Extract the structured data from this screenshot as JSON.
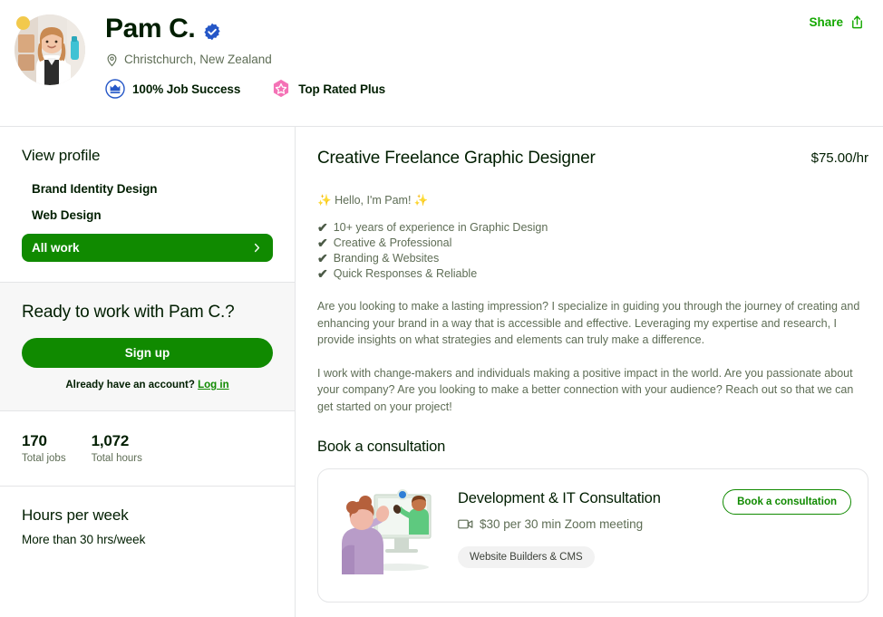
{
  "header": {
    "name": "Pam C.",
    "verified_icon": "verified-badge-icon",
    "location_icon": "location-pin-icon",
    "location": "Christchurch, New Zealand",
    "badges": [
      {
        "icon": "job-success-crown-icon",
        "label": "100% Job Success",
        "color": "#1f57c3"
      },
      {
        "icon": "top-rated-plus-star-icon",
        "label": "Top Rated Plus",
        "color": "#f472b6"
      }
    ],
    "share_label": "Share",
    "share_icon": "share-upload-icon"
  },
  "sidebar": {
    "view_profile_label": "View profile",
    "nav_items": [
      {
        "label": "Brand Identity Design"
      },
      {
        "label": "Web Design"
      }
    ],
    "all_work_label": "All work",
    "all_work_icon": "chevron-right-icon",
    "cta": {
      "title": "Ready to work with Pam C.?",
      "signup_label": "Sign up",
      "account_prompt": "Already have an account?",
      "login_label": "Log in"
    },
    "stats": [
      {
        "value": "170",
        "label": "Total jobs"
      },
      {
        "value": "1,072",
        "label": "Total hours"
      }
    ],
    "hours_per_week": {
      "title": "Hours per week",
      "value": "More than 30 hrs/week"
    }
  },
  "main": {
    "job_title": "Creative Freelance Graphic Designer",
    "rate": "$75.00/hr",
    "intro": "Hello, I'm Pam!",
    "sparkle": "✨",
    "highlights": [
      "10+ years of experience in Graphic Design",
      "Creative & Professional",
      "Branding & Websites",
      "Quick Responses & Reliable"
    ],
    "check_glyph": "✔",
    "paragraphs": [
      "Are you looking to make a lasting impression? I specialize in guiding you through the journey of creating and enhancing your brand in a way that is accessible and effective. Leveraging my expertise and research, I provide insights on what strategies and elements can truly make a difference.",
      "I work with change-makers and individuals making a positive impact in the world. Are you passionate about your company? Are you looking to make a better connection with your audience? Reach out so that we can get started on your project!"
    ],
    "consultation_section_title": "Book a consultation",
    "consultation": {
      "illustration_icon": "video-call-illustration",
      "title": "Development & IT Consultation",
      "camera_icon": "video-camera-icon",
      "price": "$30 per 30 min Zoom meeting",
      "tag": "Website Builders & CMS",
      "button_label": "Book a consultation"
    }
  },
  "colors": {
    "accent_green": "#108a00",
    "link_green": "#14a800",
    "badge_blue": "#1f57c3",
    "badge_pink": "#f472b6",
    "muted_text": "#5e6d55"
  }
}
